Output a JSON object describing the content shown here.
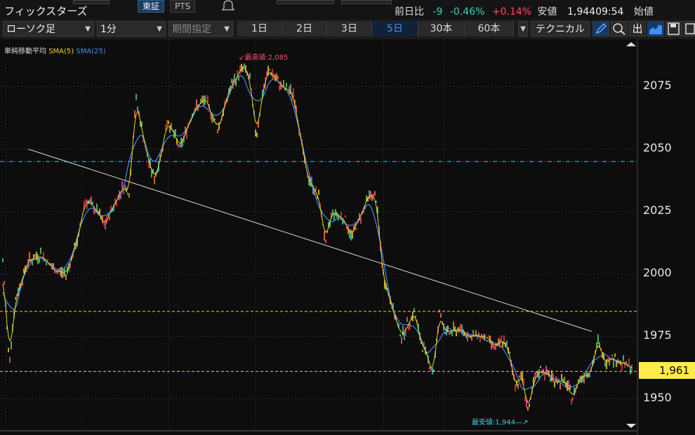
{
  "header": {
    "title": "フィックスターズ",
    "exchange_tabs": [
      "東証",
      "PTS"
    ],
    "prev_day_label": "前日比",
    "change": "-9",
    "change_pct": "-0.46%",
    "pts_change": "+0.14%",
    "low_label": "安値",
    "low_value": "1,944",
    "low_time": "09:54",
    "open_label": "始値"
  },
  "toolbar": {
    "chart_type": "ローソク足",
    "interval": "1分",
    "period": "期間指定",
    "ranges": [
      "1日",
      "2日",
      "3日",
      "5日",
      "30本",
      "60本"
    ],
    "active_range": "5日",
    "technical": "テクニカル"
  },
  "legend": {
    "indicator": "単純移動平均",
    "sma5": "SMA(5)",
    "sma25": "SMA(25)"
  },
  "annotations": {
    "high": "最高値:2,085",
    "low": "最安値:1,944"
  },
  "current_price": "1,961",
  "colors": {
    "background": "#0d0d0d",
    "sma5": "#f2d21f",
    "sma25": "#3f8ef0",
    "up": "#e83c3c",
    "down": "#3fd0c0",
    "price_badge": "#ffec4a",
    "high_label": "#ff4a6a",
    "low_label": "#3fd0e0",
    "change_down": "#3fd0c0",
    "change_up": "#ff4a6a"
  },
  "chart_data": {
    "type": "line",
    "title": "",
    "ylim": [
      1940,
      2090
    ],
    "y_ticks": [
      "2075",
      "2050",
      "2025",
      "2000",
      "1975",
      "1950"
    ],
    "series": [
      {
        "name": "SMA(25)",
        "x": [
          0,
          10,
          20,
          30,
          40,
          50,
          60,
          70,
          80,
          90,
          100
        ],
        "values": [
          2000,
          2005,
          2040,
          2062,
          2075,
          2080,
          2060,
          2025,
          1985,
          1975,
          1958
        ]
      }
    ],
    "horizontal_lines": [
      {
        "value": 2045,
        "style": "dashdot",
        "color": "#3fd0e0"
      },
      {
        "value": 1985,
        "style": "dashed",
        "color": "#f2d21f"
      },
      {
        "value": 1961,
        "style": "dashed",
        "color": "#f2d21f"
      }
    ],
    "trendline": {
      "from": [
        4,
        2050
      ],
      "to": [
        93,
        1977
      ]
    },
    "high": 2085,
    "low": 1944,
    "last": 1961
  }
}
